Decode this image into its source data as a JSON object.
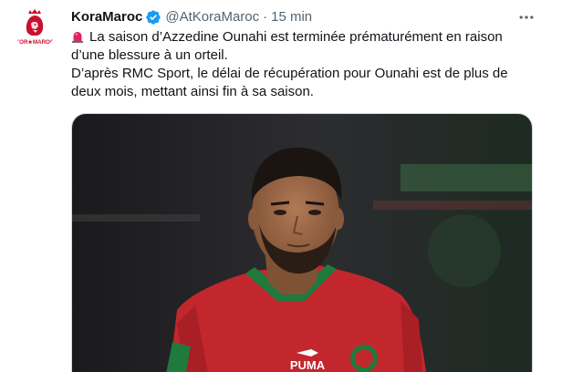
{
  "account": {
    "display_name": "KoraMaroc",
    "handle": "@AtKoraMaroc",
    "separator": "·",
    "time": "15 min",
    "verified": true,
    "avatar_text": "KOR★MAROC",
    "avatar_icon": "crowned-lion-logo"
  },
  "tweet": {
    "lines": [
      "La saison d’Azzedine Ounahi est terminée prématurément en raison",
      "d’une blessure à un orteil.",
      "D’après RMC Sport, le délai de récupération pour Ounahi est de plus de",
      "deux mois, mettant ainsi fin à sa saison."
    ],
    "leading_emoji": "siren-icon"
  },
  "media": {
    "jersey_brand": "PUMA",
    "description_icon": "football-player-photo"
  },
  "colors": {
    "text": "#0f1419",
    "secondary": "#536471",
    "verified": "#1d9bf0",
    "brand_red": "#c8102e",
    "border": "#cfd9de"
  }
}
